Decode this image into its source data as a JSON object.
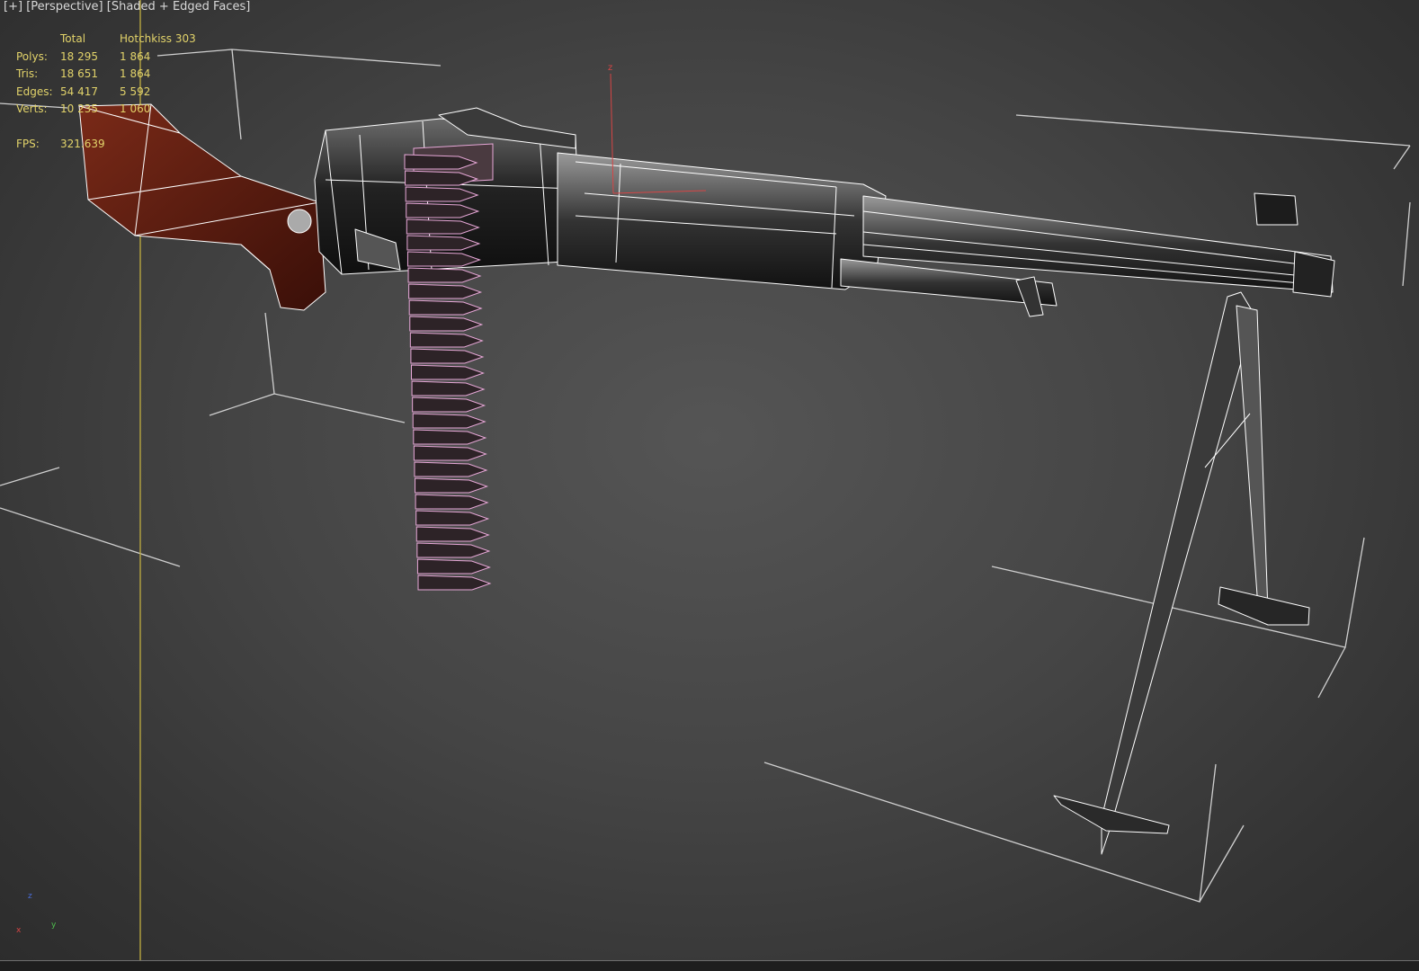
{
  "viewport": {
    "label_parts": [
      "[+]",
      "[Perspective]",
      "[Shaded + Edged Faces]"
    ]
  },
  "stats": {
    "headers": [
      "",
      "Total",
      "Hotchkiss 303"
    ],
    "rows": [
      {
        "label": "Polys:",
        "total": "18 295",
        "selected": "1 864"
      },
      {
        "label": "Tris:",
        "total": "18 651",
        "selected": "1 864"
      },
      {
        "label": "Edges:",
        "total": "54 417",
        "selected": "5 592"
      },
      {
        "label": "Verts:",
        "total": "10 235",
        "selected": "1 060"
      }
    ],
    "fps_label": "FPS:",
    "fps_value": "321.639"
  },
  "axes": {
    "z": "z",
    "gizmo_z": "z",
    "gizmo_x": "x",
    "gizmo_y": "y"
  },
  "colors": {
    "viewport_bg": "#454545",
    "stats_text": "#e2d36a",
    "wire_white": "#ffffff",
    "wire_magenta": "#e020e0",
    "wire_green": "#88ff44",
    "bullet_pink": "#e8a8d8",
    "wood": "#5a1c12",
    "metal": "#262626",
    "grid_yellow": "#b7a640",
    "axis_red": "#d64545"
  },
  "icons": [
    "axis-gizmo-icon",
    "pivot-axis-icon"
  ]
}
